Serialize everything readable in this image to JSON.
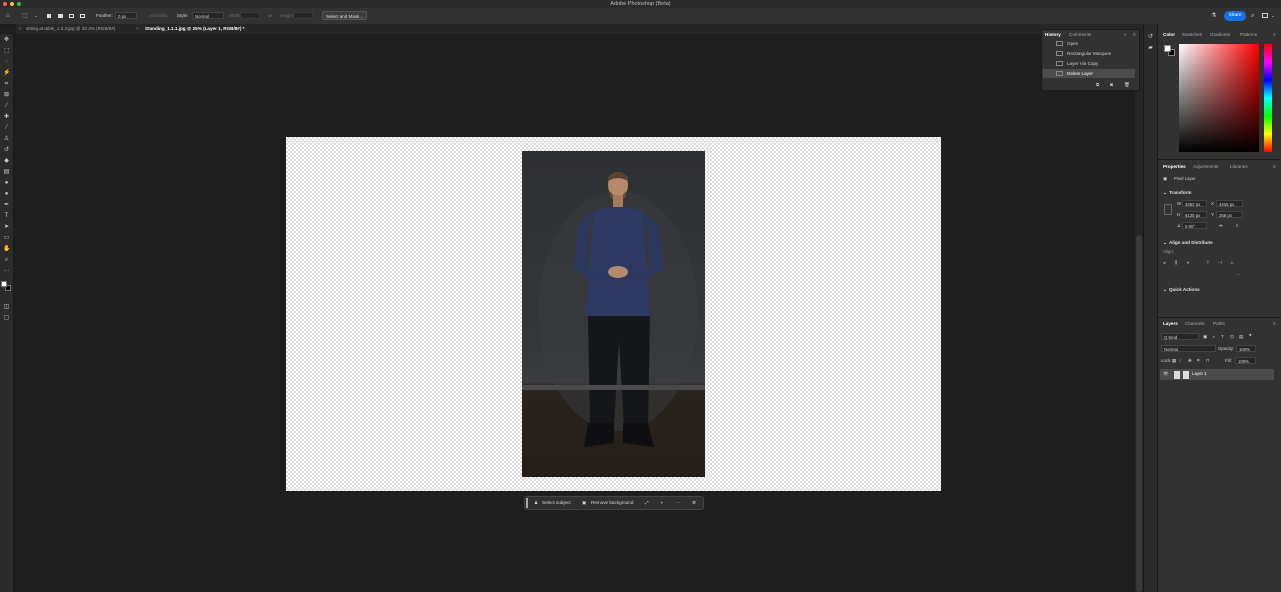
{
  "app": {
    "title": "Adobe Photoshop (Beta)"
  },
  "options_bar": {
    "feather_label": "Feather:",
    "feather_value": "0 px",
    "antialias_label": "Anti-alias",
    "style_label": "Style:",
    "style_value": "Normal",
    "width_label": "Width:",
    "height_label": "Height:",
    "select_mask_label": "Select and Mask...",
    "share_label": "Share"
  },
  "tabs": [
    {
      "label": "sitting at table_1.2.3.jpg @ 33.3% (RGB/8#)",
      "active": false
    },
    {
      "label": "Standing_1.1.1.jpg @ 25% (Layer 1, RGB/8#) *",
      "active": true
    }
  ],
  "history_panel": {
    "tabs": [
      "History",
      "Comments"
    ],
    "items": [
      "Open",
      "Rectangular Marquee",
      "Layer Via Copy",
      "Delete Layer"
    ],
    "selected_index": 3
  },
  "contextual_task_bar": {
    "select_subject": "Select subject",
    "remove_background": "Remove background",
    "more": "···"
  },
  "color_panel": {
    "tabs": [
      "Color",
      "Swatches",
      "Gradients",
      "Patterns"
    ],
    "hue_color": "#ff0000"
  },
  "properties_panel": {
    "tabs": [
      "Properties",
      "Adjustments",
      "Libraries"
    ],
    "layer_type": "Pixel Layer",
    "transform": {
      "title": "Transform",
      "w_label": "W",
      "w_value": "3452 px",
      "h_label": "H",
      "h_value": "6120 px",
      "x_label": "X",
      "x_value": "4415 px",
      "y_label": "Y",
      "y_value": "256 px",
      "angle_value": "0.00°"
    },
    "align": {
      "title": "Align and Distribute",
      "label": "Align:",
      "more": "···"
    },
    "quick_actions": {
      "title": "Quick Actions"
    }
  },
  "layers_panel": {
    "tabs": [
      "Layers",
      "Channels",
      "Paths"
    ],
    "kind_filter": "Q Kind",
    "blend_mode": "Normal",
    "opacity_label": "Opacity:",
    "opacity_value": "100%",
    "lock_label": "Lock:",
    "fill_label": "Fill:",
    "fill_value": "100%",
    "layers": [
      {
        "name": "Layer 1",
        "visible": true
      }
    ]
  },
  "colors": {
    "accent": "#1473e6",
    "panel_bg": "#323232",
    "canvas_bg": "#1e1e1e"
  }
}
